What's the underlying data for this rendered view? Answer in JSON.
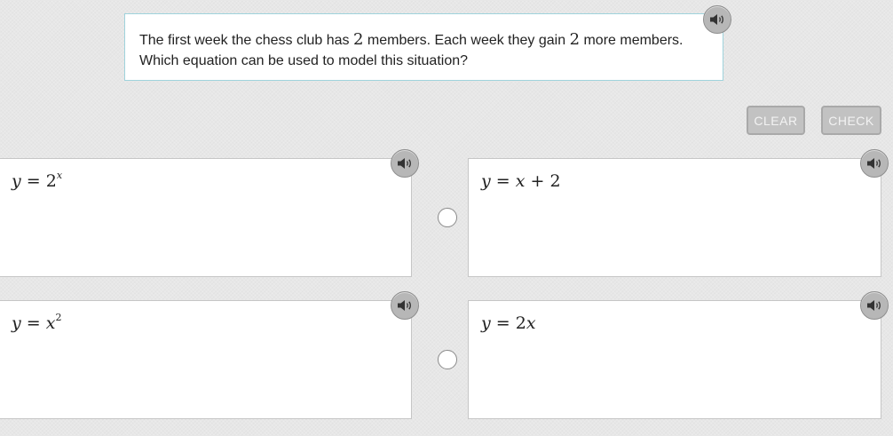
{
  "question": {
    "line1_a": "The first week the chess club has ",
    "line1_num1": "2",
    "line1_b": " members. Each week they gain ",
    "line1_num2": "2",
    "line1_c": " more members.",
    "line2": "Which equation can be used to model this situation?"
  },
  "buttons": {
    "clear_label": "CLEAR",
    "check_label": "CHECK"
  },
  "options": {
    "a": {
      "lhs": "y",
      "eq": "=",
      "base": "2",
      "exp": "x"
    },
    "b": {
      "lhs": "y",
      "eq": "=",
      "term1": "x",
      "plus": "+",
      "term2": "2"
    },
    "c": {
      "lhs": "y",
      "eq": "=",
      "base": "x",
      "exp": "2"
    },
    "d": {
      "lhs": "y",
      "eq": "=",
      "coef": "2",
      "var": "x"
    }
  },
  "icons": {
    "speaker": "speaker-icon",
    "radio": "radio-button"
  },
  "colors": {
    "question_border": "#9fd3dc",
    "button_bg": "#c2c2c2",
    "speaker_bg": "#b7b7b7"
  }
}
